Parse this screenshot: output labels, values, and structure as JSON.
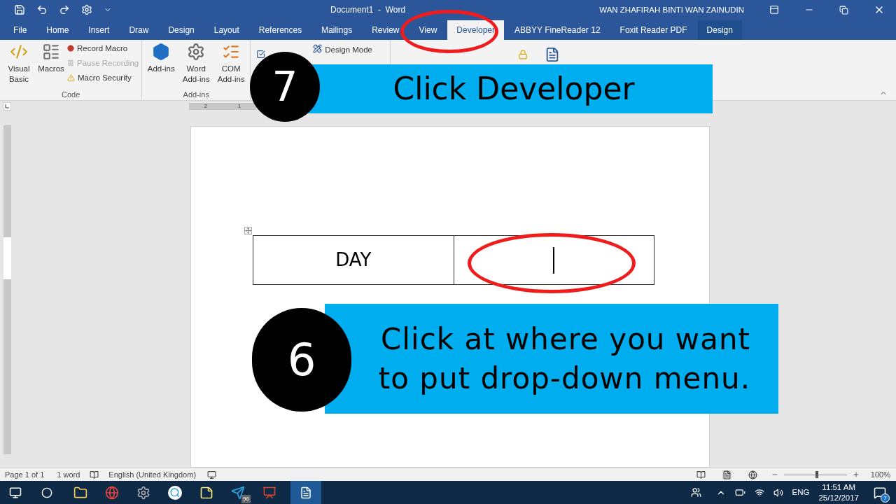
{
  "window": {
    "title": "Document1  -  Word",
    "user": "WAN ZHAFIRAH BINTI WAN ZAINUDIN"
  },
  "tabs": [
    {
      "label": "File",
      "selected": false
    },
    {
      "label": "Home",
      "selected": false
    },
    {
      "label": "Insert",
      "selected": false
    },
    {
      "label": "Draw",
      "selected": false
    },
    {
      "label": "Design",
      "selected": false
    },
    {
      "label": "Layout",
      "selected": false
    },
    {
      "label": "References",
      "selected": false
    },
    {
      "label": "Mailings",
      "selected": false
    },
    {
      "label": "Review",
      "selected": false
    },
    {
      "label": "View",
      "selected": false
    },
    {
      "label": "Developer",
      "selected": true
    },
    {
      "label": "ABBYY FineReader 12",
      "selected": false
    },
    {
      "label": "Foxit Reader PDF",
      "selected": false
    },
    {
      "label": "Design",
      "selected": false,
      "contextual": true
    }
  ],
  "ribbon": {
    "code": {
      "title": "Code",
      "visual_basic": "Visual Basic",
      "macros": "Macros",
      "record": "Record Macro",
      "pause": "Pause Recording",
      "pause_disabled": true,
      "security": "Macro Security"
    },
    "addins": {
      "title": "Add-ins",
      "items": [
        "Add-ins",
        "Word Add-ins",
        "COM Add-ins"
      ]
    },
    "controls": {
      "design_mode": "Design Mode"
    }
  },
  "ruler": {
    "marks": [
      "2",
      "1"
    ]
  },
  "table": {
    "cells": [
      {
        "text": "DAY",
        "cursor": false
      },
      {
        "text": "",
        "cursor": true
      }
    ]
  },
  "callouts": [
    {
      "number": "7",
      "text": "Click Developer"
    },
    {
      "number": "6",
      "lines": [
        "Click at where you want",
        "to put drop-down menu."
      ]
    }
  ],
  "status_bar": {
    "page": "Page 1 of 1",
    "words": "1 word",
    "language": "English (United Kingdom)",
    "zoom": "100%",
    "level": 0.5
  },
  "taskbar": {
    "telegram_badge": "96",
    "time": "11:51 AM",
    "date": "25/12/2017",
    "language": "ENG",
    "notifications": "7"
  }
}
